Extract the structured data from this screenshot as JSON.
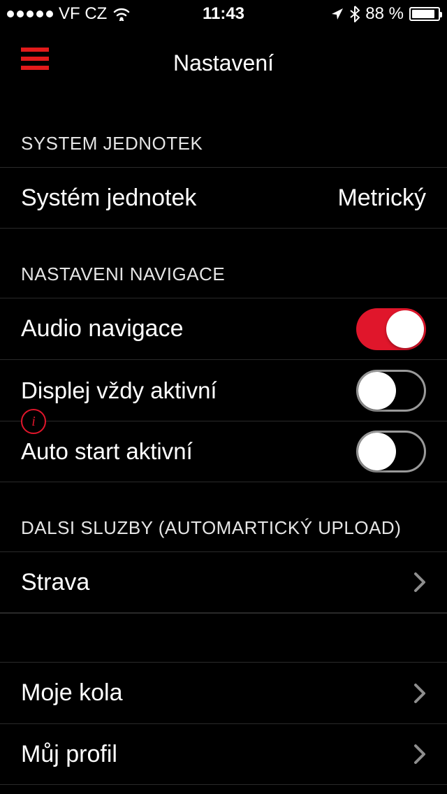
{
  "status_bar": {
    "carrier": "VF CZ",
    "time": "11:43",
    "battery_text": "88 %",
    "battery_fill_pct": 88
  },
  "navbar": {
    "title": "Nastavení"
  },
  "sections": {
    "units": {
      "header": "SYSTEM JEDNOTEK",
      "row": {
        "label": "Systém jednotek",
        "value": "Metrický"
      }
    },
    "navigation": {
      "header": "NASTAVENI NAVIGACE",
      "audio": {
        "label": "Audio navigace",
        "on": true
      },
      "display": {
        "label": "Displej vždy aktivní",
        "on": false
      },
      "auto": {
        "label": "Auto start aktivní",
        "on": false,
        "info": "i"
      }
    },
    "services": {
      "header": "DALSI SLUZBY (AUTOMARTICKÝ UPLOAD)",
      "strava": {
        "label": "Strava"
      }
    },
    "other": {
      "bikes": {
        "label": "Moje kola"
      },
      "profile": {
        "label": "Můj profil"
      }
    }
  }
}
